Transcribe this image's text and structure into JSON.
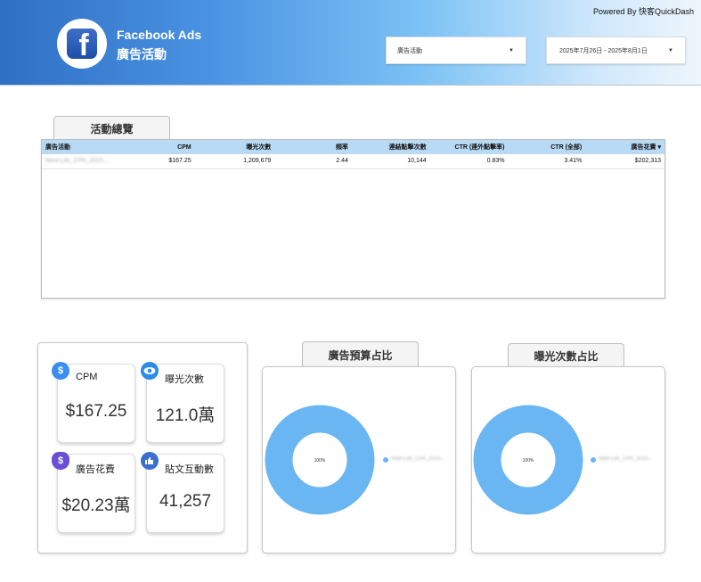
{
  "header": {
    "powered_by": "Powered By 快客QuickDash",
    "brand_title": "Facebook Ads",
    "brand_subtitle": "廣告活動",
    "campaign_filter": "廣告活動",
    "date_range": "2025年7月26日 - 2025年8月1日"
  },
  "overview": {
    "tab_label": "活動總覽",
    "columns": [
      "廣告活動",
      "CPM",
      "曝光次數",
      "頻率",
      "連結點擊次數",
      "CTR (連外點擊率)",
      "CTR (全部)",
      "廣告花費 ▾"
    ],
    "rows": [
      [
        "New-Lds_CPA_2025...",
        "$167.25",
        "1,209,679",
        "2.44",
        "10,144",
        "0.83%",
        "3.41%",
        "$202,313"
      ]
    ]
  },
  "kpis": [
    {
      "label": "CPM",
      "value": "$167.25",
      "icon": "dollar-icon",
      "color": "#3b8ef0"
    },
    {
      "label": "曝光次數",
      "value": "121.0萬",
      "icon": "eye-icon",
      "color": "#2d8be8"
    },
    {
      "label": "廣告花費",
      "value": "$20.23萬",
      "icon": "money-bag-icon",
      "color": "#6a4fd6"
    },
    {
      "label": "貼文互動數",
      "value": "41,257",
      "icon": "interaction-icon",
      "color": "#3a6fd0"
    }
  ],
  "budget_share": {
    "tab_label": "廣告預算占比",
    "center_label": "100%",
    "legend": "New-Lds_CPA_2025...",
    "color": "#6ab6f2"
  },
  "impression_share": {
    "tab_label": "曝光次數占比",
    "center_label": "100%",
    "legend": "New-Lds_CPA_2025...",
    "color": "#6ab6f2"
  }
}
